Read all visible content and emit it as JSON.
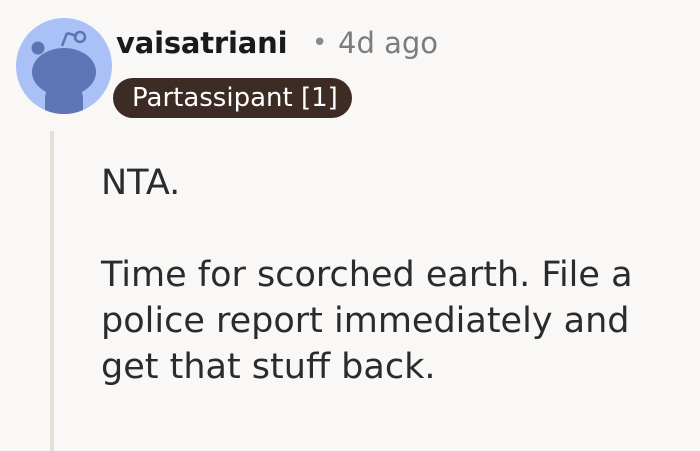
{
  "comment": {
    "author": "vaisatriani",
    "separator": "•",
    "timestamp": "4d ago",
    "flair": "Partassipant [1]",
    "paragraphs": [
      "NTA.",
      "Time for scorched earth. File a police report immediately and get that stuff back."
    ]
  },
  "colors": {
    "background": "#faf8f6",
    "avatar_background": "#a9c1f7",
    "avatar_figure": "#5d75b4",
    "flair_background": "#3d2c25",
    "flair_text": "#ffffff",
    "thread_line": "#e4ded6",
    "username_text": "#1a1a1b",
    "timestamp_text": "#7c7c7c"
  },
  "icons": {
    "avatar": "reddit-snoo-avatar-icon"
  }
}
